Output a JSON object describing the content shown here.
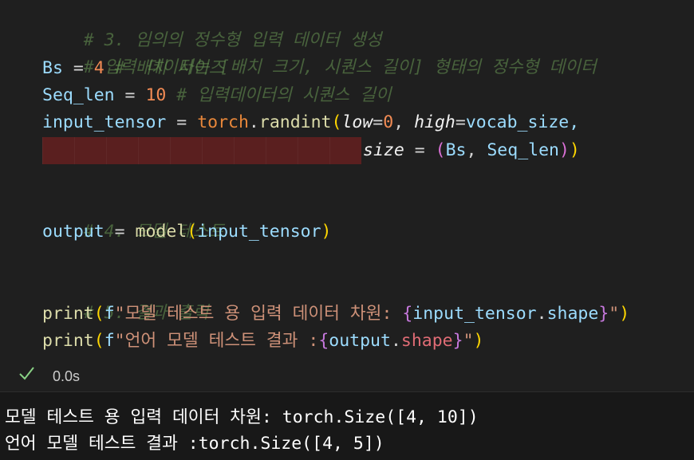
{
  "code": {
    "l1_comment": "# 3. 임의의 정수형 입력 데이터 생성",
    "l2_comment": "# 입력 데이터는 [배치 크기, 시퀀스 길이] 형태의 정수형 데이터",
    "l3_var": "Bs",
    "l3_eq": " = ",
    "l3_val": "4",
    "l3_comment": " # 배치 사이즈",
    "l4_var": "Seq_len",
    "l4_eq": " = ",
    "l4_val": "10",
    "l4_comment": " # 입력데이터의 시퀀스 길이",
    "l5_var": "input_tensor",
    "l5_eq": " = ",
    "l5_mod": "torch",
    "l5_dot": ".",
    "l5_fn": "randint",
    "l5_paren": "(",
    "l5_p1": "low",
    "l5_eq1": "=",
    "l5_v1": "0",
    "l5_comma": ", ",
    "l5_p2": "high",
    "l5_eq2": "=",
    "l5_v2": "vocab_size,",
    "l6_p": "size",
    "l6_eq": " = ",
    "l6_open": "(",
    "l6_v1": "Bs",
    "l6_comma": ", ",
    "l6_v2": "Seq_len",
    "l6_close1": ")",
    "l6_close2": ")",
    "l8_comment": "# 4. 모델 테스트",
    "l9_var": "output",
    "l9_eq": " = ",
    "l9_fn": "model",
    "l9_open": "(",
    "l9_arg": "input_tensor",
    "l9_close": ")",
    "l11_comment": "# 5. 결과 출력",
    "l12_fn": "print",
    "l12_open": "(",
    "l12_f": "f",
    "l12_str": "\"모델 테스트 용 입력 데이터 차원: ",
    "l12_bo": "{",
    "l12_expr_var": "input_tensor",
    "l12_dot": ".",
    "l12_attr": "shape",
    "l12_bc": "}",
    "l12_end": "\"",
    "l12_close": ")",
    "l13_fn": "print",
    "l13_open": "(",
    "l13_f": "f",
    "l13_str": "\"언어 모델 테스트 결과 :",
    "l13_bo": "{",
    "l13_expr_var": "output",
    "l13_dot": ".",
    "l13_attr": "shape",
    "l13_bc": "}",
    "l13_end": "\"",
    "l13_close": ")"
  },
  "status": {
    "time": "0.0s",
    "icon": "check-icon"
  },
  "output": {
    "line1": "모델 테스트 용 입력 데이터 차원: torch.Size([4, 10])",
    "line2": "언어 모델 테스트 결과 :torch.Size([4, 5])"
  }
}
